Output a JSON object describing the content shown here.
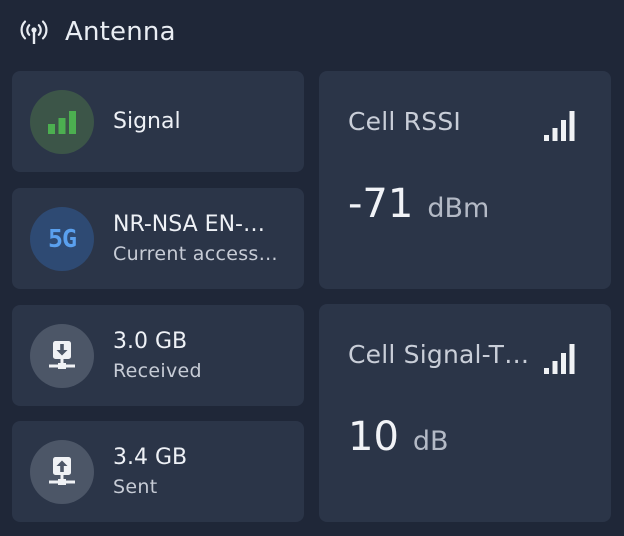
{
  "header": {
    "title": "Antenna",
    "icon": "antenna-icon"
  },
  "tiles": {
    "signal": {
      "primary": "Signal",
      "icon": "signal-bars-icon",
      "badge_color": "#3c5548",
      "icon_color": "#4caf50"
    },
    "access": {
      "primary": "NR-NSA EN-…",
      "secondary": "Current access…",
      "icon": "5g-icon",
      "badge_color": "#2e4a73",
      "icon_color": "#5aa0ee",
      "icon_text": "5G"
    },
    "received": {
      "primary": "3.0 GB",
      "secondary": "Received",
      "icon": "download-network-icon"
    },
    "sent": {
      "primary": "3.4 GB",
      "secondary": "Sent",
      "icon": "upload-network-icon"
    }
  },
  "sensors": {
    "rssi": {
      "label": "Cell RSSI",
      "value": "-71",
      "unit": "dBm",
      "icon": "signal-strength-icon"
    },
    "snr": {
      "label": "Cell Signal-T…",
      "value": "10",
      "unit": "dB",
      "icon": "signal-strength-icon"
    }
  },
  "colors": {
    "background": "#1f2738",
    "card": "#2b3548"
  }
}
